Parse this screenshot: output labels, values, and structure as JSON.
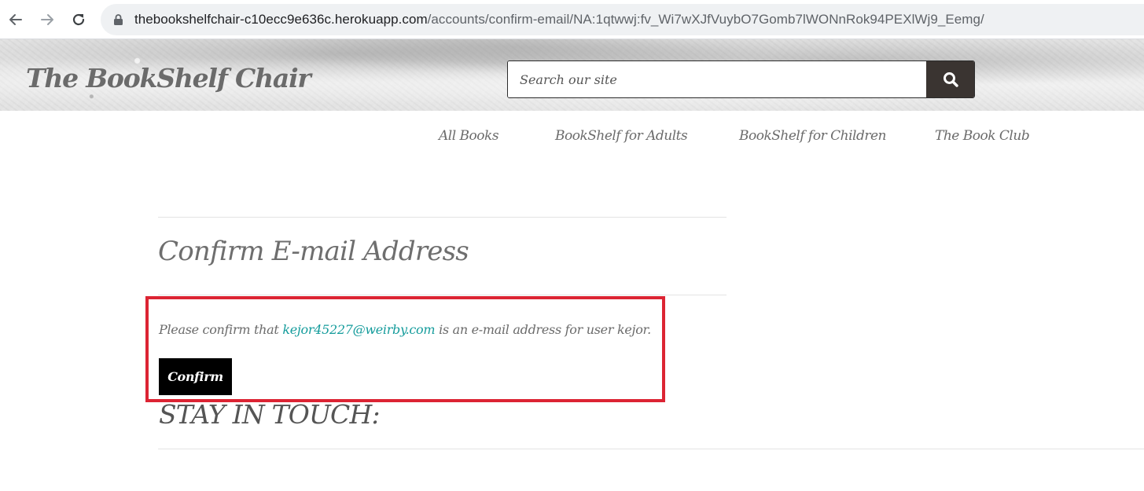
{
  "browser": {
    "url_host": "thebookshelfchair-c10ecc9e636c.herokuapp.com",
    "url_path": "/accounts/confirm-email/NA:1qtwwj:fv_Wi7wXJfVuybO7Gomb7lWONnRok94PEXlWj9_Eemg/",
    "icons": [
      "back-arrow-icon",
      "forward-arrow-icon",
      "reload-icon",
      "lock-icon"
    ]
  },
  "header": {
    "logo": "The BookShelf Chair",
    "search": {
      "placeholder": "Search our site",
      "value": "",
      "button_icon": "search-icon"
    }
  },
  "nav": {
    "items": [
      {
        "label": "All Books"
      },
      {
        "label": "BookShelf for Adults"
      },
      {
        "label": "BookShelf for Children"
      },
      {
        "label": "The Book Club"
      }
    ]
  },
  "main": {
    "title": "Confirm E-mail Address",
    "message_prefix": "Please confirm that",
    "email": "kejor45227@weirby.com",
    "message_suffix": "is an e-mail address for user kejor.",
    "confirm_label": "Confirm"
  },
  "footer": {
    "heading": "STAY IN TOUCH:"
  },
  "colors": {
    "highlight_border": "#dc2433",
    "email_link": "#159c9c",
    "search_button_bg": "#3a3431",
    "confirm_button_bg": "#000000"
  }
}
